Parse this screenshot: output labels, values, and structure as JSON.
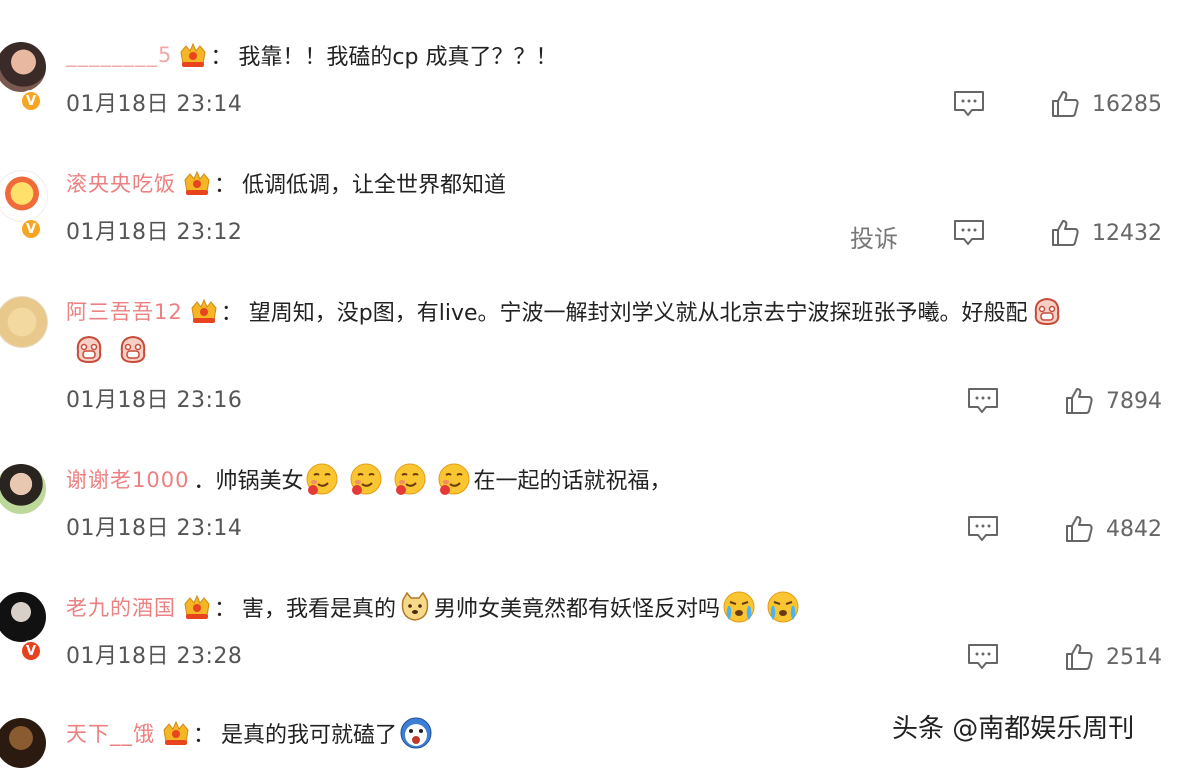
{
  "comments": [
    {
      "username": "________5",
      "text": "我靠！！我磕的cp 成真了？？！",
      "time": "01月18日 23:14",
      "likes": "16285",
      "report": ""
    },
    {
      "username": "滚央央吃饭",
      "text": "低调低调，让全世界都知道",
      "time": "01月18日 23:12",
      "likes": "12432",
      "report": "投诉"
    },
    {
      "username": "阿三吾吾12",
      "text_a": "望周知，没p图，有live。宁波一解封刘学义就从北京去宁波探班张予曦。好般配",
      "time": "01月18日 23:16",
      "likes": "7894"
    },
    {
      "username": "谢谢老1000",
      "text_a": "．帅锅美女",
      "text_b": "在一起的话就祝福，",
      "time": "01月18日 23:14",
      "likes": "4842"
    },
    {
      "username": "老九的酒国",
      "text_a": "害，我看是真的",
      "text_b": "男帅女美竟然都有妖怪反对吗",
      "time": "01月18日 23:28",
      "likes": "2514"
    },
    {
      "username": "天下__饿",
      "text_a": "是真的我可就磕了"
    }
  ],
  "watermark": "头条 @南都娱乐周刊",
  "icons": {
    "comment": "comment-icon",
    "like": "thumbs-up-icon",
    "crown": "crown-badge-icon",
    "verified": "verified-v-icon"
  },
  "colors": {
    "username": "#eb6a6a",
    "verified_orange": "#f6a623",
    "verified_red": "#e8411d"
  }
}
